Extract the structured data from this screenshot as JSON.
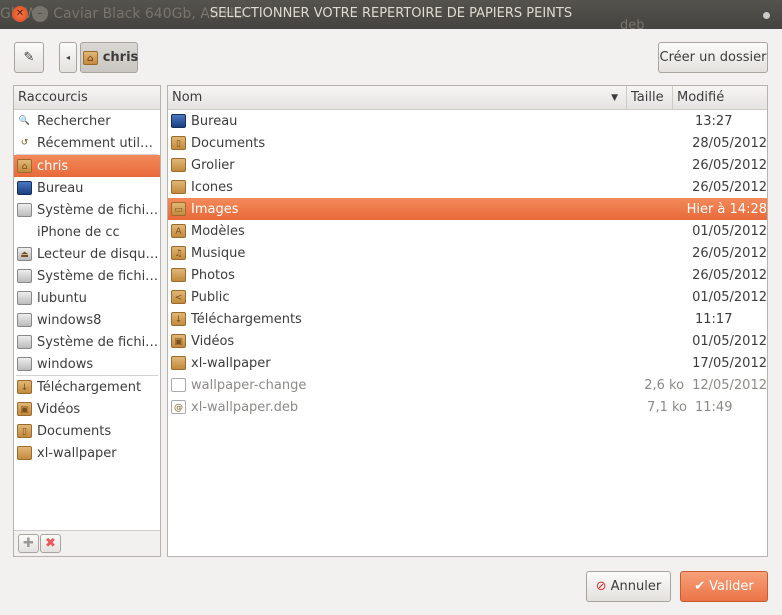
{
  "window": {
    "title": "SELECTIONNER VOTRE REPERTOIRE DE PAPIERS PEINTS",
    "background_text": "Gb WD Caviar Black 640Gb, Ati HD",
    "background_text2": "deb"
  },
  "toolbar": {
    "path_button": "chris",
    "create_folder": "Créer un dossier"
  },
  "sidebar": {
    "header": "Raccourcis",
    "groups": [
      [
        {
          "label": "Rechercher",
          "icon": "search"
        },
        {
          "label": "Récemment util…",
          "icon": "recent"
        }
      ],
      [
        {
          "label": "chris",
          "icon": "home-folder",
          "selected": true
        },
        {
          "label": "Bureau",
          "icon": "desktop"
        },
        {
          "label": "Système de fichi…",
          "icon": "drive"
        },
        {
          "label": "iPhone de cc",
          "icon": "none"
        },
        {
          "label": "Lecteur de disqu…",
          "icon": "eject-drive"
        },
        {
          "label": "Système de fichi…",
          "icon": "drive"
        },
        {
          "label": "lubuntu",
          "icon": "drive"
        },
        {
          "label": "windows8",
          "icon": "drive"
        },
        {
          "label": "Système de fichi…",
          "icon": "drive"
        },
        {
          "label": "windows",
          "icon": "drive"
        }
      ],
      [
        {
          "label": "Téléchargement",
          "icon": "download-folder"
        },
        {
          "label": "Vidéos",
          "icon": "video-folder"
        },
        {
          "label": "Documents",
          "icon": "documents-folder"
        },
        {
          "label": "xl-wallpaper",
          "icon": "folder"
        }
      ]
    ]
  },
  "files": {
    "columns": {
      "name": "Nom",
      "size": "Taille",
      "modified": "Modifié"
    },
    "rows": [
      {
        "name": "Bureau",
        "size": "",
        "modified": "13:27",
        "icon": "desktop"
      },
      {
        "name": "Documents",
        "size": "",
        "modified": "28/05/2012",
        "icon": "documents-folder"
      },
      {
        "name": "Grolier",
        "size": "",
        "modified": "26/05/2012",
        "icon": "folder"
      },
      {
        "name": "Icones",
        "size": "",
        "modified": "26/05/2012",
        "icon": "folder"
      },
      {
        "name": "Images",
        "size": "",
        "modified": "Hier à 14:28",
        "icon": "pictures-folder",
        "selected": true
      },
      {
        "name": "Modèles",
        "size": "",
        "modified": "01/05/2012",
        "icon": "templates-folder"
      },
      {
        "name": "Musique",
        "size": "",
        "modified": "26/05/2012",
        "icon": "music-folder"
      },
      {
        "name": "Photos",
        "size": "",
        "modified": "26/05/2012",
        "icon": "folder"
      },
      {
        "name": "Public",
        "size": "",
        "modified": "01/05/2012",
        "icon": "public-folder"
      },
      {
        "name": "Téléchargements",
        "size": "",
        "modified": "11:17",
        "icon": "download-folder"
      },
      {
        "name": "Vidéos",
        "size": "",
        "modified": "01/05/2012",
        "icon": "video-folder"
      },
      {
        "name": "xl-wallpaper",
        "size": "",
        "modified": "17/05/2012",
        "icon": "folder"
      },
      {
        "name": "wallpaper-change",
        "size": "2,6 ko",
        "modified": "12/05/2012",
        "icon": "text-file",
        "dimmed": true
      },
      {
        "name": "xl-wallpaper.deb",
        "size": "7,1 ko",
        "modified": "11:49",
        "icon": "debian-package",
        "dimmed": true
      }
    ]
  },
  "buttons": {
    "cancel": "Annuler",
    "ok": "Valider"
  },
  "colors": {
    "accent": "#f07746",
    "titlebar": "#4c4a45"
  }
}
